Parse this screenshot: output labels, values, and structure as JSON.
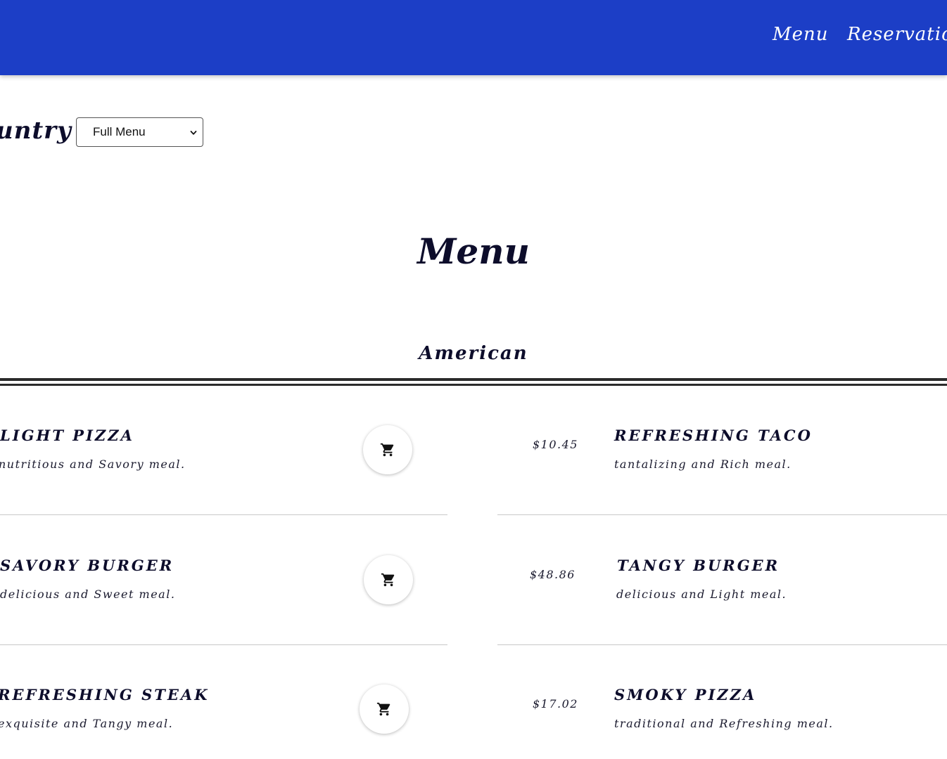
{
  "nav": {
    "menu_label": "Menu",
    "reservations_label": "Reservation"
  },
  "filter": {
    "label": "untry",
    "selected": "Full Menu"
  },
  "page": {
    "title": "Menu",
    "section": "American"
  },
  "items_left": [
    {
      "name": "Light Pizza",
      "description": "nutritious and Savory meal."
    },
    {
      "name": "Savory Burger",
      "description": "delicious and Sweet meal."
    },
    {
      "name": "Refreshing Steak",
      "description": "exquisite and Tangy meal."
    }
  ],
  "items_right": [
    {
      "price": "$10.45",
      "name": "Refreshing Taco",
      "description": "tantalizing and Rich meal."
    },
    {
      "price": "$48.86",
      "name": "Tangy Burger",
      "description": "delicious and Light meal."
    },
    {
      "price": "$17.02",
      "name": "Smoky Pizza",
      "description": "traditional and Refreshing meal."
    }
  ],
  "icons": {
    "cart": "shopping-cart-icon",
    "dropdown": "chevron-down-icon"
  },
  "colors": {
    "header_bg": "#1c3ec6",
    "text": "#0d0d2b"
  }
}
